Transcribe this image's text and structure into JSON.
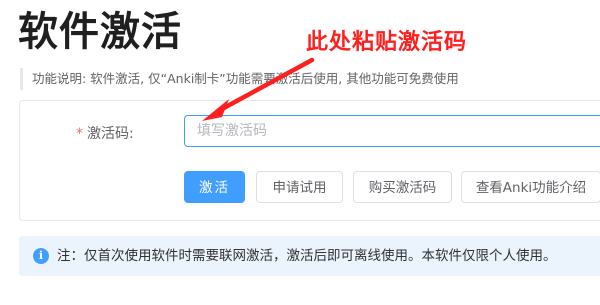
{
  "page": {
    "title": "软件激活",
    "description": "功能说明: 软件激活, 仅“Anki制卡”功能需要激活后使用, 其他功能可免费使用"
  },
  "form": {
    "required_mark": "*",
    "code_label": "激活码:",
    "code_placeholder": "填写激活码",
    "code_value": ""
  },
  "buttons": {
    "activate": "激活",
    "apply_trial": "申请试用",
    "buy_code": "购买激活码",
    "view_anki": "查看Anki功能介绍"
  },
  "annotation": {
    "text": "此处粘贴激活码",
    "color": "#ff1f1f"
  },
  "notice": {
    "icon": "info-icon",
    "text": "注：仅首次使用软件时需要联网激活，激活后即可离线使用。本软件仅限个人使用。"
  },
  "colors": {
    "primary": "#409eff",
    "required": "#f56c6c",
    "notice_bg": "#ebf4fd"
  }
}
